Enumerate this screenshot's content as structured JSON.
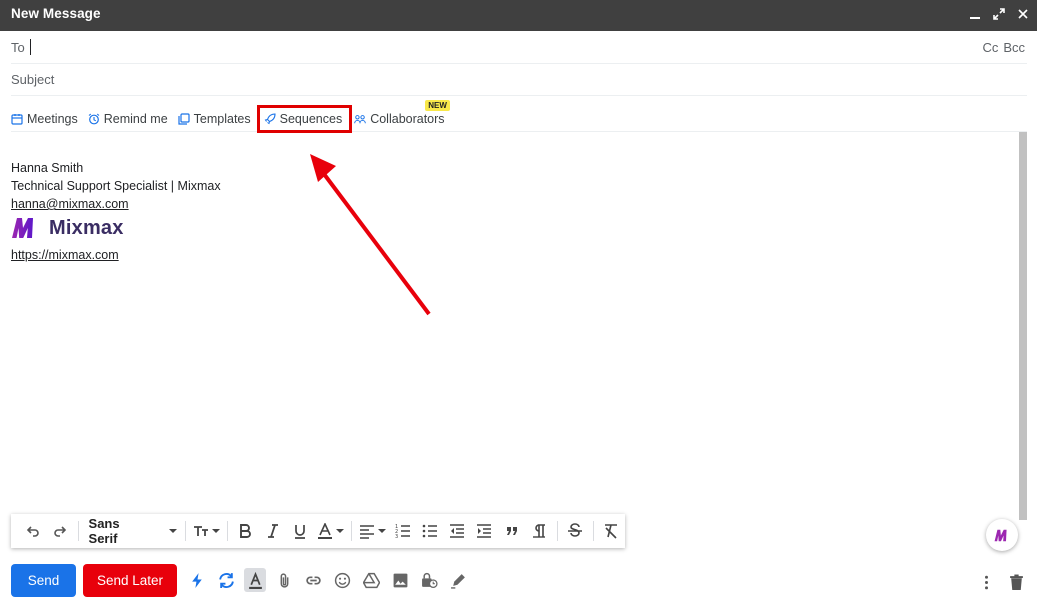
{
  "window": {
    "title": "New Message"
  },
  "fields": {
    "to_label": "To",
    "cc_label": "Cc",
    "bcc_label": "Bcc",
    "subject_placeholder": "Subject"
  },
  "mixmax_toolbar": {
    "items": [
      {
        "label": "Meetings",
        "icon": "calendar-icon"
      },
      {
        "label": "Remind me",
        "icon": "alarm-clock-icon"
      },
      {
        "label": "Templates",
        "icon": "templates-icon"
      },
      {
        "label": "Sequences",
        "icon": "rocket-icon",
        "highlighted": true
      },
      {
        "label": "Collaborators",
        "icon": "people-icon",
        "badge": "NEW"
      }
    ]
  },
  "signature": {
    "name": "Hanna Smith",
    "role": "Technical Support Specialist | Mixmax",
    "email": "hanna@mixmax.com",
    "logo_text": "Mixmax",
    "website": "https://mixmax.com"
  },
  "format_toolbar": {
    "font": "Sans Serif"
  },
  "actions": {
    "send": "Send",
    "send_later": "Send Later"
  },
  "colors": {
    "titlebar": "#404040",
    "send_button": "#1a73e8",
    "send_later_button": "#e8000b",
    "highlight": "#e00000",
    "badge": "#f9e84a",
    "mixmax_purple": "#7b1fd6"
  }
}
